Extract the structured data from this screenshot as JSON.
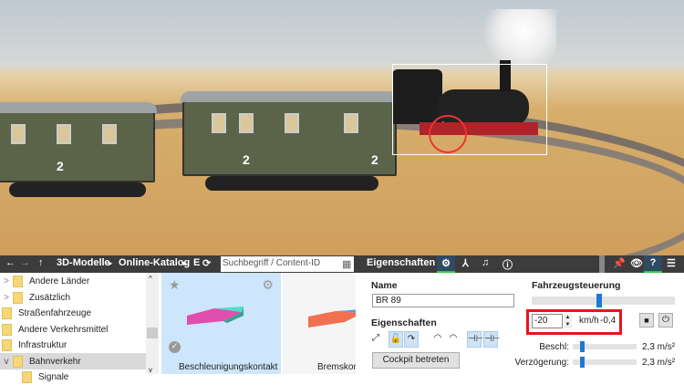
{
  "viewport": {
    "coach_numbers": [
      "2",
      "2",
      "2"
    ]
  },
  "toolbar": {
    "back_icon": "arrow-left",
    "forward_icon": "arrow-right",
    "up_icon": "arrow-up",
    "breadcrumb": [
      "3D-Modelle",
      "Online-Katalog",
      "E"
    ],
    "refresh_icon": "refresh",
    "search_placeholder": "Suchbegriff / Content-ID",
    "grid_icon": "grid",
    "panel_title": "Eigenschaften"
  },
  "tree": [
    {
      "label": "Andere Länder",
      "expand": ">"
    },
    {
      "label": "Zusätzlich",
      "expand": ">"
    },
    {
      "label": "Straßenfahrzeuge",
      "expand": ""
    },
    {
      "label": "Andere Verkehrsmittel",
      "expand": ""
    },
    {
      "label": "Infrastruktur",
      "expand": ""
    },
    {
      "label": "Bahnverkehr",
      "expand": "v"
    },
    {
      "label": "Signale",
      "expand": ""
    }
  ],
  "catalog": [
    {
      "label": "Beschleunigungskontakt"
    },
    {
      "label": "Bremskontakt"
    }
  ],
  "props": {
    "name_label": "Name",
    "name_value": "BR 89",
    "eigenschaften_label": "Eigenschaften",
    "cockpit_button": "Cockpit betreten",
    "control_label": "Fahrzeugsteuerung",
    "speed_value": "-20",
    "speed_unit": "km/h",
    "actual_speed": "-0,4",
    "speed_slider": 0.45,
    "accel_label": "Beschl:",
    "accel_value": "2,3 m/s²",
    "accel_slider": 0.12,
    "decel_label": "Verzögerung:",
    "decel_value": "2,3 m/s²",
    "decel_slider": 0.12
  },
  "colors": {
    "highlight": "#e8141c",
    "accent": "#1e78d4"
  }
}
